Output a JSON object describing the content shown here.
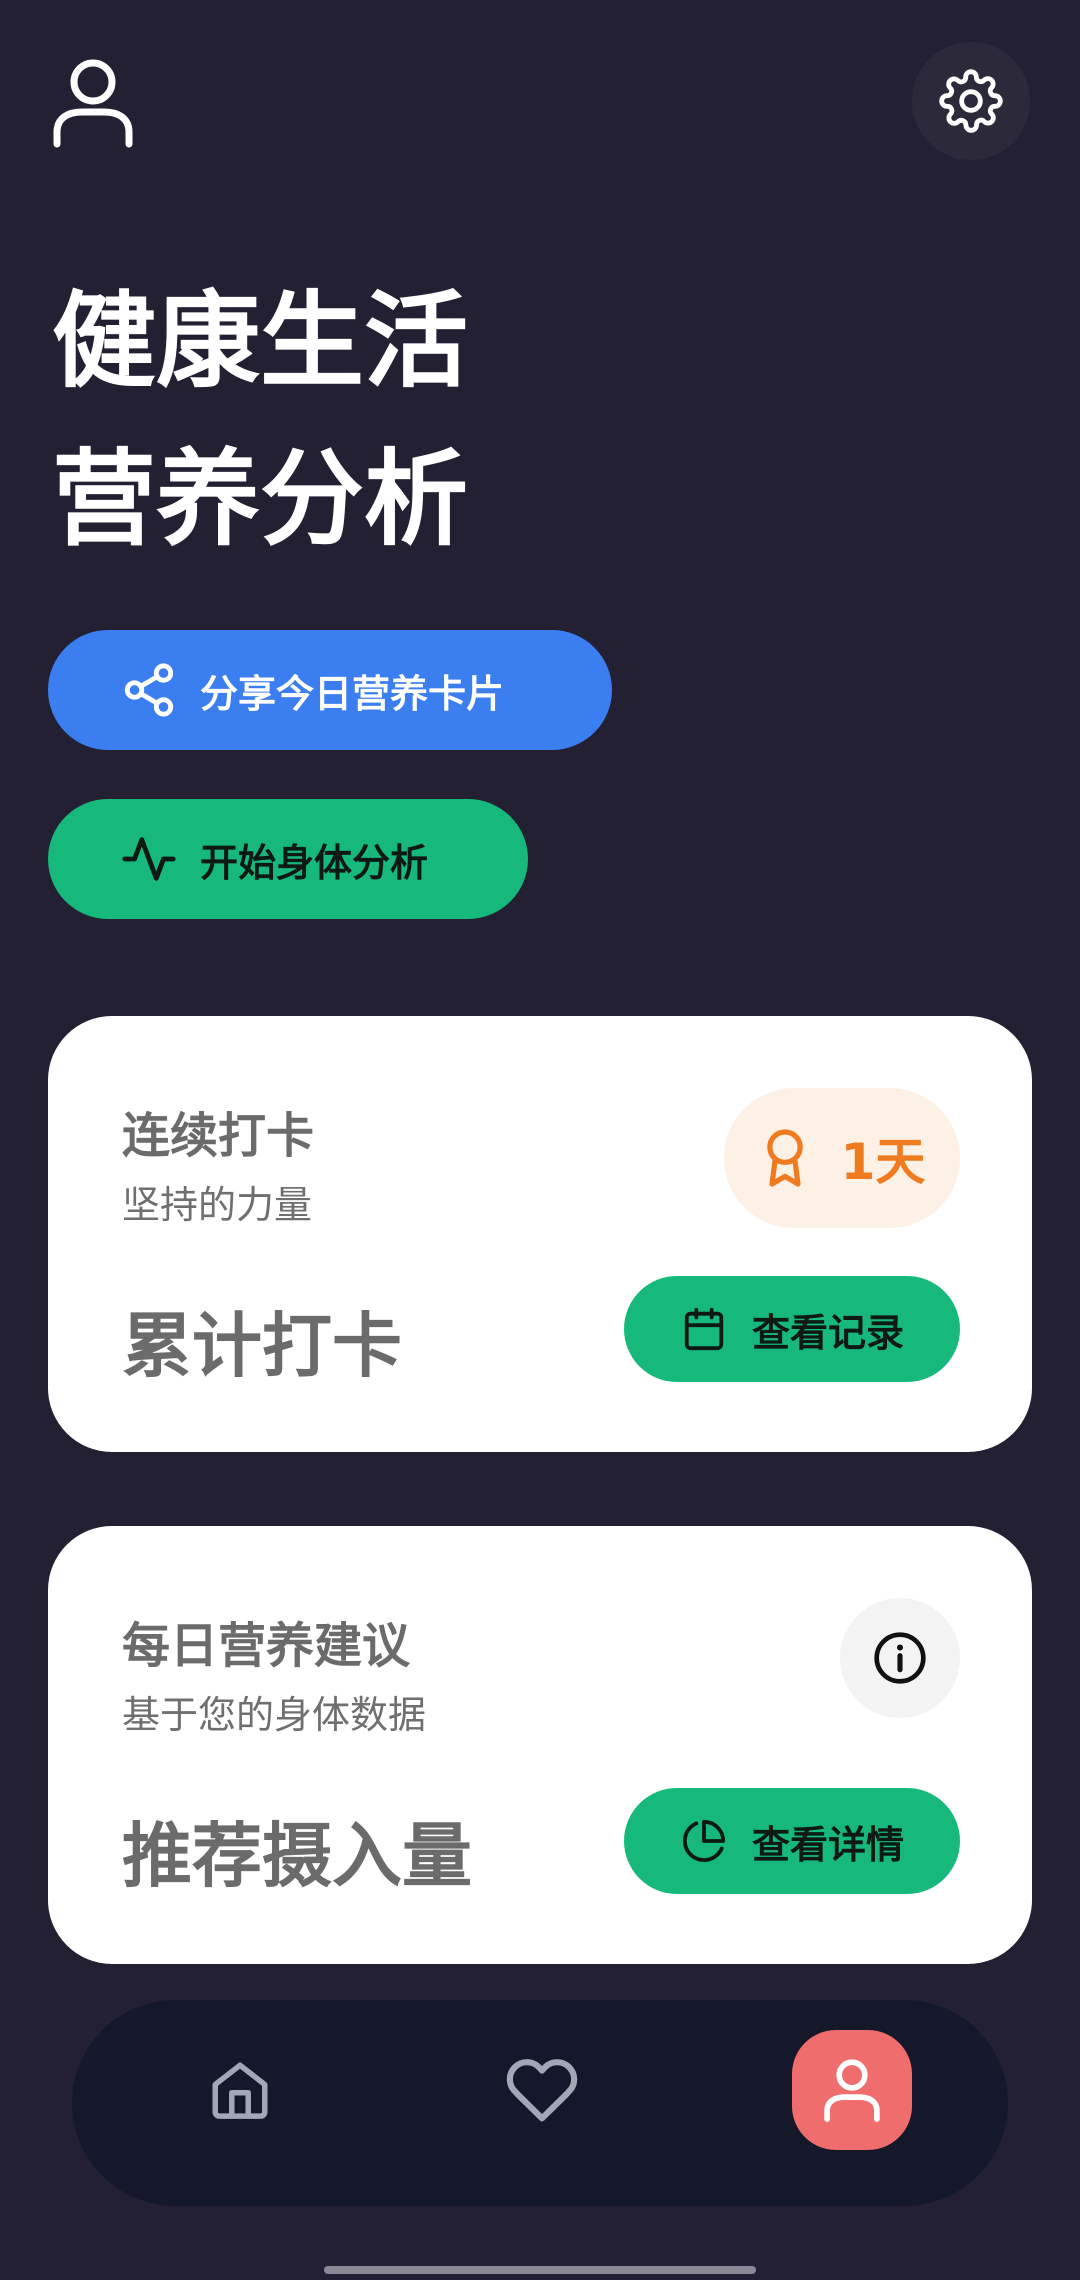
{
  "header": {
    "user_icon": "user-icon",
    "settings_icon": "gear-icon"
  },
  "hero": {
    "line1": "健康生活",
    "line2": "营养分析"
  },
  "actions": {
    "share_label": "分享今日营养卡片",
    "share_icon": "share-icon",
    "analyze_label": "开始身体分析",
    "analyze_icon": "activity-icon"
  },
  "streak_card": {
    "title": "连续打卡",
    "subtitle": "坚持的力量",
    "big_label": "累计打卡",
    "badge_value": "1天",
    "badge_icon": "award-icon",
    "button_label": "查看记录",
    "button_icon": "calendar-icon"
  },
  "nutrition_card": {
    "title": "每日营养建议",
    "subtitle": "基于您的身体数据",
    "big_label": "推荐摄入量",
    "info_icon": "info-icon",
    "button_label": "查看详情",
    "button_icon": "pie-chart-icon"
  },
  "bottom_nav": {
    "items": [
      {
        "icon": "home-icon",
        "active": false
      },
      {
        "icon": "heart-icon",
        "active": false
      },
      {
        "icon": "user-icon",
        "active": true
      }
    ]
  },
  "colors": {
    "background": "#232034",
    "share_blue": "#3b7ef0",
    "green": "#16b97b",
    "orange": "#f07a1e",
    "active_nav": "#ef6d6d"
  }
}
